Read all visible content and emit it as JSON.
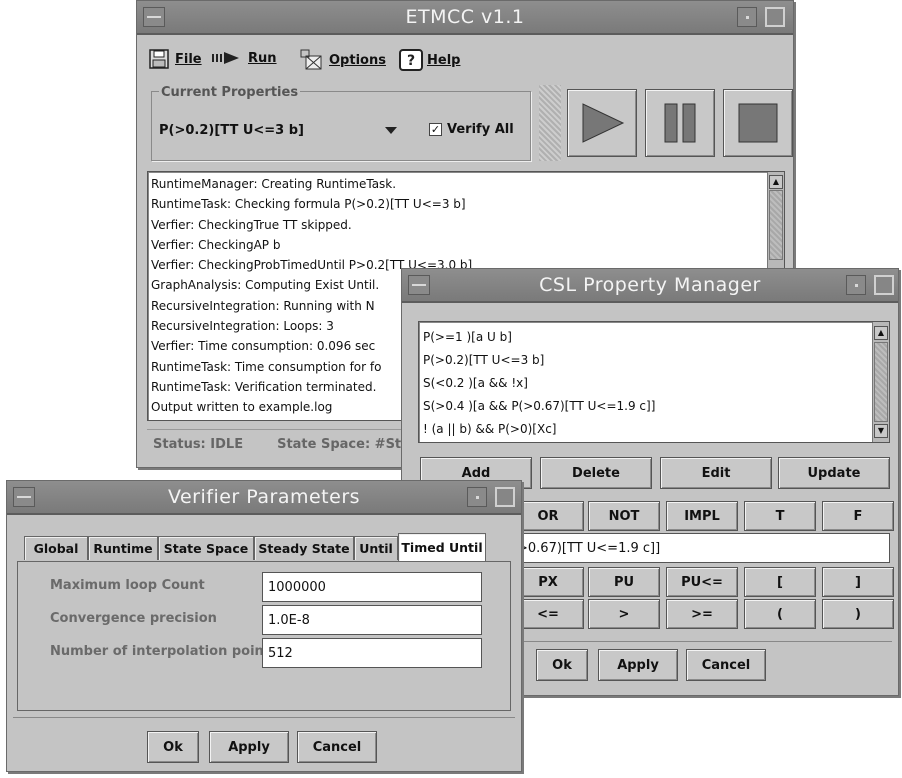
{
  "etmcc": {
    "title": "ETMCC v1.1",
    "menu": {
      "file": "File",
      "run": "Run",
      "options": "Options",
      "help": "Help"
    },
    "properties_group_label": "Current Properties",
    "selected_property": "P(>0.2)[TT U<=3 b]",
    "verify_all_label": "Verify All",
    "verify_all_checked": true,
    "log_lines": [
      "RuntimeManager: Creating RuntimeTask.",
      "RuntimeTask: Checking formula P(>0.2)[TT U<=3 b]",
      "Verfier: CheckingTrue TT skipped.",
      "Verfier: CheckingAP b",
      "Verfier: CheckingProbTimedUntil P>0.2[TT U<=3.0 b]",
      "GraphAnalysis: Computing Exist Until.",
      "RecursiveIntegration: Running with N",
      "RecursiveIntegration: Loops: 3",
      "Verfier:  Time consumption: 0.096 sec",
      "RuntimeTask: Time consumption for fo",
      "RuntimeTask: Verification terminated.",
      "Output written to example.log"
    ],
    "status": "Status: IDLE",
    "state_space": "State Space:  #St"
  },
  "csl": {
    "title": "CSL Property Manager",
    "properties": [
      "P(>=1 )[a U b]",
      "P(>0.2)[TT U<=3 b]",
      "S(<0.2 )[a && !x]",
      "S(>0.4 )[a && P(>0.67)[TT U<=1.9 c]]",
      "! (a || b) && P(>0)[Xc]"
    ],
    "buttons": {
      "add": "Add",
      "delete": "Delete",
      "edit": "Edit",
      "update": "Update"
    },
    "op_row1": [
      "OR",
      "NOT",
      "IMPL",
      "T",
      "F"
    ],
    "formula": ">0.67)[TT U<=1.9 c]]",
    "op_row2": [
      "PX",
      "PU",
      "PU<=",
      "[",
      "]"
    ],
    "op_row3": [
      "<=",
      ">",
      ">=",
      "(",
      ")"
    ],
    "footer": {
      "ok": "Ok",
      "apply": "Apply",
      "cancel": "Cancel"
    }
  },
  "verifier": {
    "title": "Verifier Parameters",
    "tabs": [
      "Global",
      "Runtime",
      "State Space",
      "Steady State",
      "Until",
      "Timed Until"
    ],
    "active_tab": "Timed Until",
    "params": [
      {
        "label": "Maximum loop Count",
        "value": "1000000"
      },
      {
        "label": "Convergence precision",
        "value": "1.0E-8"
      },
      {
        "label": "Number of interpolation points",
        "value": "512"
      }
    ],
    "footer": {
      "ok": "Ok",
      "apply": "Apply",
      "cancel": "Cancel"
    }
  },
  "colors": {
    "window_bg": "#c4c4c4",
    "titlebar": "#838383",
    "field_bg": "#ffffff",
    "play_icon": "#7a7a7a"
  }
}
